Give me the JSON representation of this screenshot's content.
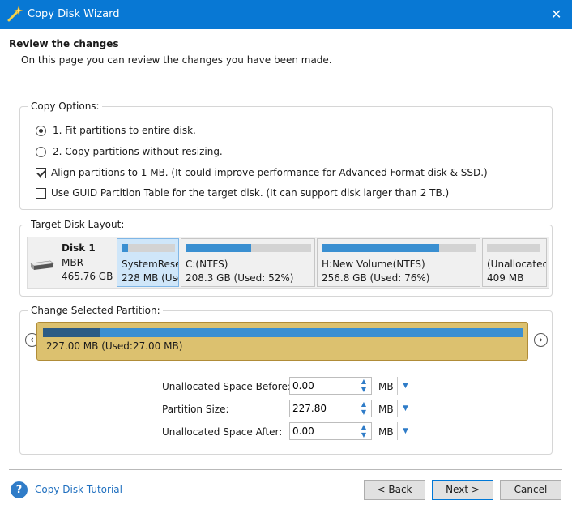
{
  "window": {
    "title": "Copy Disk Wizard",
    "close_glyph": "✕",
    "icon": "wizard-wand-icon"
  },
  "header": {
    "title": "Review the changes",
    "subtitle": "On this page you can review the changes you have been made."
  },
  "copy_options": {
    "legend": "Copy Options:",
    "options": [
      {
        "label": "1. Fit partitions to entire disk.",
        "type": "radio",
        "checked": true
      },
      {
        "label": "2. Copy partitions without resizing.",
        "type": "radio",
        "checked": false
      },
      {
        "label": "Align partitions to 1 MB.  (It could improve performance for Advanced Format disk & SSD.)",
        "type": "checkbox",
        "checked": true
      },
      {
        "label": "Use GUID Partition Table for the target disk. (It can support disk larger than 2 TB.)",
        "type": "checkbox",
        "checked": false
      }
    ]
  },
  "target_disk": {
    "legend": "Target Disk Layout:",
    "disk": {
      "name": "Disk 1",
      "type": "MBR",
      "size": "465.76 GB"
    },
    "partitions": [
      {
        "name": "SystemRese",
        "size": "228 MB (Use",
        "used_fraction": 0.12,
        "selected": true
      },
      {
        "name": "C:(NTFS)",
        "size": "208.3 GB (Used: 52%)",
        "used_fraction": 0.52,
        "selected": false
      },
      {
        "name": "H:New Volume(NTFS)",
        "size": "256.8 GB (Used: 76%)",
        "used_fraction": 0.76,
        "selected": false
      },
      {
        "name": "(Unallocatec",
        "size": "409 MB",
        "used_fraction": 0.0,
        "selected": false
      }
    ]
  },
  "change_partition": {
    "legend": "Change Selected Partition:",
    "bar_label": "227.00 MB (Used:27.00 MB)",
    "used_fraction": 0.12,
    "prev_glyph": "‹",
    "next_glyph": "›",
    "fields": [
      {
        "label": "Unallocated Space Before:",
        "value": "0.00",
        "unit": "MB"
      },
      {
        "label": "Partition Size:",
        "value": "227.80",
        "unit": "MB"
      },
      {
        "label": "Unallocated Space After:",
        "value": "0.00",
        "unit": "MB"
      }
    ]
  },
  "footer": {
    "help_glyph": "?",
    "tutorial_link": "Copy Disk Tutorial",
    "back_label": "< Back",
    "next_label": "Next >",
    "cancel_label": "Cancel"
  },
  "colors": {
    "titlebar": "#0878d4",
    "partition_used": "#3a8fd1",
    "partition_selected": "#cfe6f9",
    "gold_bar": "#dcc16f",
    "link": "#1f6fbf"
  }
}
